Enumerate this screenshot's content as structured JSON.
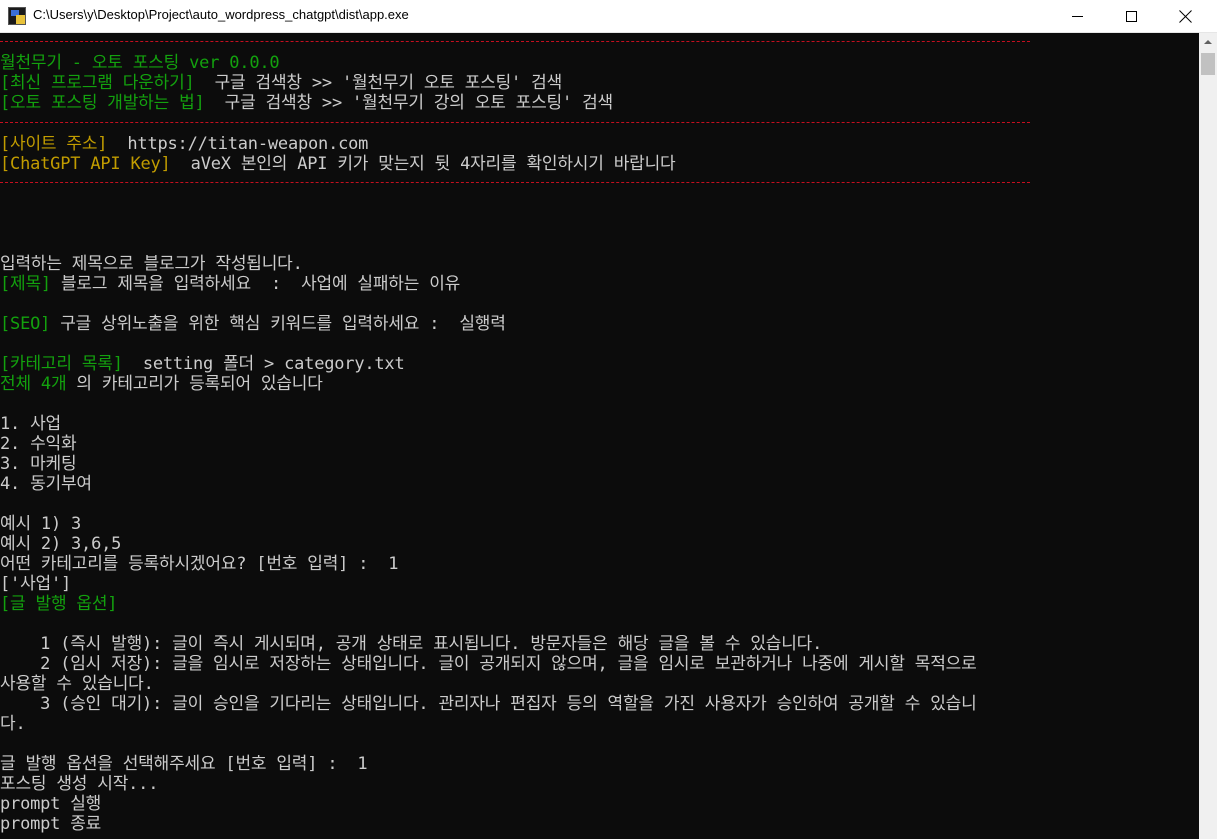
{
  "window": {
    "title": "C:\\Users\\y\\Desktop\\Project\\auto_wordpress_chatgpt\\dist\\app.exe",
    "icon": "console-app-icon",
    "controls": {
      "minimize": "minimize-icon",
      "maximize": "maximize-icon",
      "close": "close-icon"
    }
  },
  "colors": {
    "background": "#0c0c0c",
    "green": "#13a10e",
    "yellow": "#c19c00",
    "gray": "#cccccc",
    "red_rule": "#c50f1f"
  },
  "console": {
    "header": {
      "title": "월천무기 - 오토 포스팅 ver 0.0.0",
      "download_label": "[최신 프로그램 다운하기]",
      "download_text": "  구글 검색창 >> '월천무기 오토 포스팅' 검색",
      "howto_label": "[오토 포스팅 개발하는 법]",
      "howto_text": "  구글 검색창 >> '월천무기 강의 오토 포스팅' 검색"
    },
    "site": {
      "site_label": "[사이트 주소]",
      "site_value": "  https://titan-weapon.com",
      "api_label": "[ChatGPT API Key]",
      "api_value": "  aVeX 본인의 API 키가 맞는지 뒷 4자리를 확인하시기 바랍니다"
    },
    "body": {
      "intro": "입력하는 제목으로 블로그가 작성됩니다.",
      "title_label": "[제목]",
      "title_prompt": " 블로그 제목을 입력하세요  :  사업에 실패하는 이유",
      "seo_label": "[SEO]",
      "seo_prompt": " 구글 상위노출을 위한 핵심 키워드를 입력하세요 :  실행력",
      "category_label": "[카테고리 목록]",
      "category_path": "  setting 폴더 > category.txt",
      "category_count": "전체 4개",
      "category_count_suffix": " 의 카테고리가 등록되어 있습니다",
      "categories": [
        "1. 사업",
        "2. 수익화",
        "3. 마케팅",
        "4. 동기부여"
      ],
      "example1": "예시 1) 3",
      "example2": "예시 2) 3,6,5",
      "category_question": "어떤 카테고리를 등록하시겠어요? [번호 입력] :  1",
      "selected_category": "['사업']",
      "publish_label": "[글 발행 옵션]",
      "publish_option1": "    1 (즉시 발행): 글이 즉시 게시되며, 공개 상태로 표시됩니다. 방문자들은 해당 글을 볼 수 있습니다.",
      "publish_option2a": "    2 (임시 저장): 글을 임시로 저장하는 상태입니다. 글이 공개되지 않으며, 글을 임시로 보관하거나 나중에 게시할 목적으로",
      "publish_option2b": "사용할 수 있습니다.",
      "publish_option3a": "    3 (승인 대기): 글이 승인을 기다리는 상태입니다. 관리자나 편집자 등의 역할을 가진 사용자가 승인하여 공개할 수 있습니",
      "publish_option3b": "다.",
      "publish_question": "글 발행 옵션을 선택해주세요 [번호 입력] :  1",
      "status1": "포스팅 생성 시작...",
      "status2": "prompt 실행",
      "status3": "prompt 종료"
    }
  }
}
